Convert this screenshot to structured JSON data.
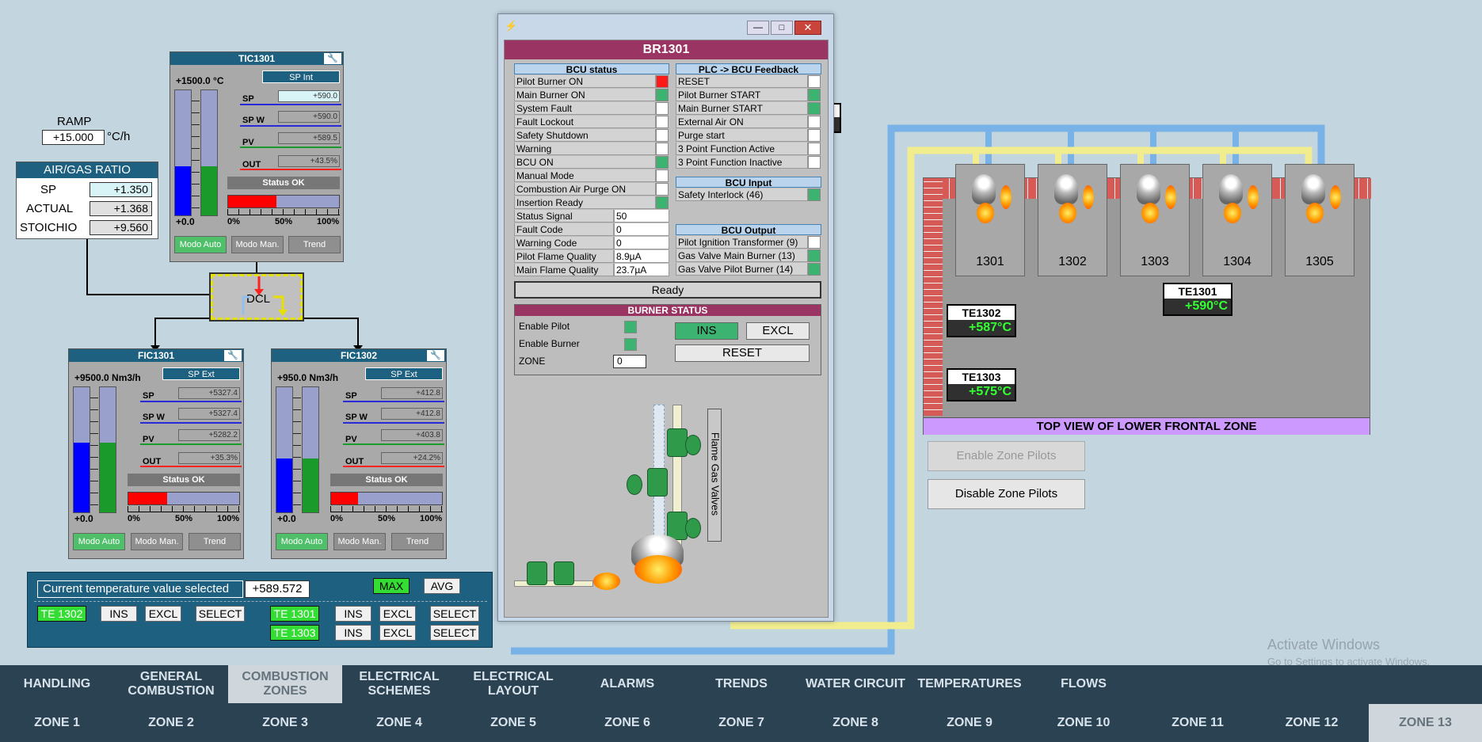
{
  "ramp": {
    "label": "RAMP",
    "value": "+15.000",
    "unit": "°C/h"
  },
  "airgas": {
    "title": "AIR/GAS RATIO",
    "rows": [
      {
        "label": "SP",
        "value": "+1.350"
      },
      {
        "label": "ACTUAL",
        "value": "+1.368"
      },
      {
        "label": "STOICHIO",
        "value": "+9.560"
      }
    ]
  },
  "dcl": {
    "label": "DCL"
  },
  "tic": {
    "title": "TIC1301",
    "wrench": "🔧",
    "range": "+1500.0 °C",
    "sp_mode": "SP Int",
    "zero": "+0.0",
    "sp": "+590.0",
    "spw": "+590.0",
    "pv": "+589.5",
    "out": "+43.5%",
    "status": "Status OK",
    "out_fraction": 0.435,
    "fill_a": 0.39,
    "fill_b": 0.39
  },
  "fic1": {
    "title": "FIC1301",
    "wrench": "🔧",
    "range": "+9500.0 Nm3/h",
    "sp_mode": "SP Ext",
    "zero": "+0.0",
    "sp": "+5327.4",
    "spw": "+5327.4",
    "pv": "+5282.2",
    "out": "+35.3%",
    "status": "Status OK",
    "out_fraction": 0.353,
    "fill_a": 0.56,
    "fill_b": 0.56
  },
  "fic2": {
    "title": "FIC1302",
    "wrench": "🔧",
    "range": "+950.0 Nm3/h",
    "sp_mode": "SP Ext",
    "zero": "+0.0",
    "sp": "+412.8",
    "spw": "+412.8",
    "pv": "+403.8",
    "out": "+24.2%",
    "status": "Status OK",
    "out_fraction": 0.242,
    "fill_a": 0.43,
    "fill_b": 0.43
  },
  "faceplate_labels": {
    "sp": "SP",
    "spw": "SP W",
    "pv": "PV",
    "out": "OUT",
    "t0": "0%",
    "t50": "50%",
    "t100": "100%",
    "auto": "Modo Auto",
    "man": "Modo Man.",
    "trend": "Trend"
  },
  "tempsel": {
    "label": "Current temperature value selected",
    "value": "+589.572",
    "max": "MAX",
    "avg": "AVG",
    "rows": [
      {
        "tag": "TE 1302",
        "ins": "INS",
        "excl": "EXCL",
        "select": "SELECT"
      },
      {
        "tag": "TE 1301",
        "ins": "INS",
        "excl": "EXCL",
        "select": "SELECT"
      },
      {
        "tag": "TE 1303",
        "ins": "INS",
        "excl": "EXCL",
        "select": "SELECT"
      }
    ]
  },
  "window": {
    "title": "BR1301",
    "bcu_status": {
      "header": "BCU status",
      "rows": [
        {
          "label": "Pilot Burner ON",
          "state": "red"
        },
        {
          "label": "Main Burner ON",
          "state": "green"
        },
        {
          "label": "System Fault",
          "state": "white"
        },
        {
          "label": "Fault Lockout",
          "state": "white"
        },
        {
          "label": "Safety Shutdown",
          "state": "white"
        },
        {
          "label": "Warning",
          "state": "white"
        },
        {
          "label": "BCU ON",
          "state": "green"
        },
        {
          "label": "Manual Mode",
          "state": "white"
        },
        {
          "label": "Combustion Air Purge ON",
          "state": "white"
        },
        {
          "label": "Insertion Ready",
          "state": "green"
        }
      ],
      "values": [
        {
          "label": "Status Signal",
          "value": "50"
        },
        {
          "label": "Fault Code",
          "value": "0"
        },
        {
          "label": "Warning Code",
          "value": "0"
        },
        {
          "label": "Pilot Flame Quality",
          "value": "8.9µA"
        },
        {
          "label": "Main Flame Quality",
          "value": "23.7µA"
        }
      ]
    },
    "plc_feedback": {
      "header": "PLC -> BCU Feedback",
      "rows": [
        {
          "label": "RESET",
          "state": "white"
        },
        {
          "label": "Pilot Burner START",
          "state": "green"
        },
        {
          "label": "Main Burner START",
          "state": "green"
        },
        {
          "label": "External Air ON",
          "state": "white"
        },
        {
          "label": "Purge start",
          "state": "white"
        },
        {
          "label": "3 Point Function Active",
          "state": "white"
        },
        {
          "label": "3 Point Function Inactive",
          "state": "white"
        }
      ]
    },
    "bcu_input": {
      "header": "BCU Input",
      "rows": [
        {
          "label": "Safety Interlock (46)",
          "state": "green"
        }
      ]
    },
    "bcu_output": {
      "header": "BCU Output",
      "rows": [
        {
          "label": "Pilot Ignition Transformer (9)",
          "state": "white"
        },
        {
          "label": "Gas Valve Main Burner (13)",
          "state": "green"
        },
        {
          "label": "Gas Valve Pilot Burner (14)",
          "state": "green"
        }
      ]
    },
    "ready": "Ready",
    "burner_status": {
      "header": "BURNER STATUS",
      "enable_pilot": "Enable Pilot",
      "enable_burner": "Enable Burner",
      "zone": "ZONE",
      "zone_value": "0",
      "ins": "INS",
      "excl": "EXCL",
      "reset": "RESET"
    },
    "valves_label": "Flame Gas Valves"
  },
  "zone_view": {
    "title": "TOP VIEW OF LOWER FRONTAL ZONE",
    "burners": [
      "1301",
      "1302",
      "1303",
      "1304",
      "1305"
    ],
    "tags": [
      {
        "tag": "TE1301",
        "value": "+590°C"
      },
      {
        "tag": "TE1302",
        "value": "+587°C"
      },
      {
        "tag": "TE1303",
        "value": "+575°C"
      }
    ],
    "enable_pilots": "Enable Zone Pilots",
    "disable_pilots": "Disable Zone Pilots"
  },
  "watermark": {
    "line1": "Activate Windows",
    "line2": "Go to Settings to activate Windows."
  },
  "nav": {
    "top": [
      "HANDLING",
      "GENERAL COMBUSTION",
      "COMBUSTION ZONES",
      "ELECTRICAL SCHEMES",
      "ELECTRICAL LAYOUT",
      "ALARMS",
      "TRENDS",
      "WATER CIRCUIT",
      "TEMPERATURES",
      "FLOWS"
    ],
    "bottom": [
      "ZONE 1",
      "ZONE 2",
      "ZONE 3",
      "ZONE 4",
      "ZONE 5",
      "ZONE 6",
      "ZONE 7",
      "ZONE 8",
      "ZONE 9",
      "ZONE 10",
      "ZONE 11",
      "ZONE 12",
      "ZONE 13"
    ],
    "selected_top": "COMBUSTION ZONES",
    "selected_bottom": "ZONE 13"
  },
  "colors": {
    "green": "#3cb371",
    "red": "#ff1a1a",
    "blue_bar": "#0000ff",
    "green_bar": "#1a9a2a",
    "nav": "#2b4253",
    "zone_title": "#cc99ff",
    "wall": "#d9534f"
  }
}
